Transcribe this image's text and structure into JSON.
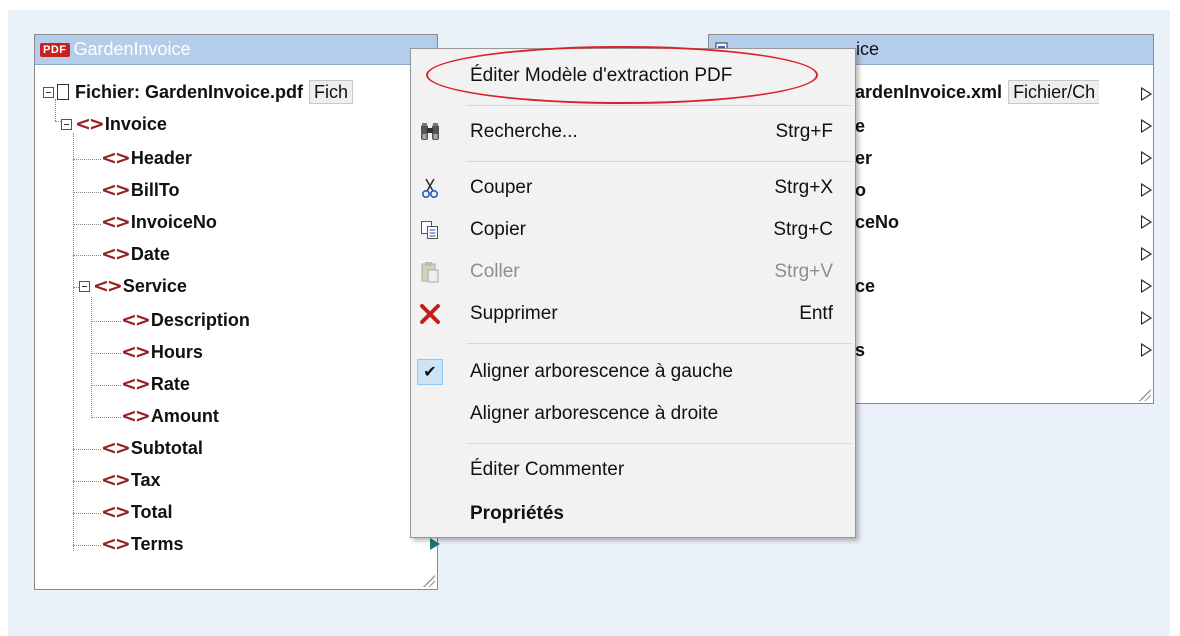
{
  "left_component": {
    "title": "GardenInvoice",
    "badge": "PDF",
    "file_label": "Fichier: GardenInvoice.pdf",
    "file_button": "Fich",
    "tree": [
      {
        "label": "Invoice",
        "level": 1
      },
      {
        "label": "Header",
        "level": 2
      },
      {
        "label": "BillTo",
        "level": 2
      },
      {
        "label": "InvoiceNo",
        "level": 2
      },
      {
        "label": "Date",
        "level": 2
      },
      {
        "label": "Service",
        "level": 2
      },
      {
        "label": "Description",
        "level": 3
      },
      {
        "label": "Hours",
        "level": 3
      },
      {
        "label": "Rate",
        "level": 3
      },
      {
        "label": "Amount",
        "level": 3
      },
      {
        "label": "Subtotal",
        "level": 2
      },
      {
        "label": "Tax",
        "level": 2
      },
      {
        "label": "Total",
        "level": 2
      },
      {
        "label": "Terms",
        "level": 2
      }
    ]
  },
  "right_component": {
    "title_fragment": "ice",
    "file_label_fragment": "ardenInvoice.xml",
    "file_button": "Fichier/Ch",
    "visible_fragments": [
      "e",
      "er",
      "o",
      "ceNo",
      "",
      "ce",
      "",
      "s"
    ]
  },
  "context_menu": {
    "items": [
      {
        "label": "Éditer Modèle d'extraction PDF",
        "shortcut": "",
        "icon": ""
      },
      {
        "label": "Recherche...",
        "shortcut": "Strg+F",
        "icon": "binoculars-icon"
      },
      {
        "label": "Couper",
        "shortcut": "Strg+X",
        "icon": "scissors-icon"
      },
      {
        "label": "Copier",
        "shortcut": "Strg+C",
        "icon": "copy-icon"
      },
      {
        "label": "Coller",
        "shortcut": "Strg+V",
        "icon": "paste-icon",
        "disabled": true
      },
      {
        "label": "Supprimer",
        "shortcut": "Entf",
        "icon": "delete-x-icon"
      },
      {
        "label": "Aligner arborescence à gauche",
        "shortcut": "",
        "icon": "checkmark-icon",
        "checked": true
      },
      {
        "label": "Aligner arborescence à droite",
        "shortcut": "",
        "icon": ""
      },
      {
        "label": "Éditer Commenter",
        "shortcut": "",
        "icon": ""
      },
      {
        "label": "Propriétés",
        "shortcut": "",
        "icon": "",
        "bold": true
      }
    ]
  },
  "colors": {
    "canvas_bg": "#eaf1f8",
    "titlebar": "#b4cdea",
    "tag_icon": "#9a1d1d",
    "highlight_ellipse": "#d9222a",
    "delete_icon": "#c41f1f"
  }
}
